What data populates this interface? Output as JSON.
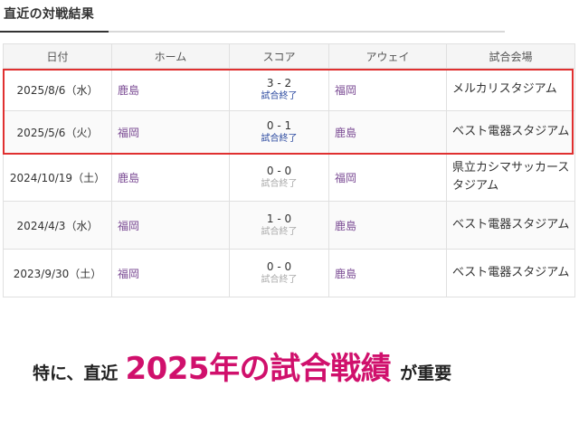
{
  "section_title": "直近の対戦結果",
  "table": {
    "headers": [
      "日付",
      "ホーム",
      "スコア",
      "アウェイ",
      "試合会場"
    ],
    "rows": [
      {
        "date": "2025/8/6（水）",
        "home": "鹿島",
        "score": "3 - 2",
        "status": "試合終了",
        "away": "福岡",
        "venue": "メルカリスタジアム"
      },
      {
        "date": "2025/5/6（火）",
        "home": "福岡",
        "score": "0 - 1",
        "status": "試合終了",
        "away": "鹿島",
        "venue": "ベスト電器スタジアム"
      },
      {
        "date": "2024/10/19（土）",
        "home": "鹿島",
        "score": "0 - 0",
        "status": "試合終了",
        "away": "福岡",
        "venue": "県立カシマサッカースタジアム"
      },
      {
        "date": "2024/4/3（水）",
        "home": "福岡",
        "score": "1 - 0",
        "status": "試合終了",
        "away": "鹿島",
        "venue": "ベスト電器スタジアム"
      },
      {
        "date": "2023/9/30（土）",
        "home": "福岡",
        "score": "0 - 0",
        "status": "試合終了",
        "away": "鹿島",
        "venue": "ベスト電器スタジアム"
      }
    ]
  },
  "caption": {
    "part1": "特に、直近",
    "part2": "2025年の試合戦績",
    "part3": "が重要"
  },
  "colors": {
    "team_link": "#7a4a93",
    "status_recent": "#2c4aa0",
    "status_old": "#aaaaaa",
    "highlight_border": "#e03030",
    "caption_accent": "#d0106c"
  }
}
